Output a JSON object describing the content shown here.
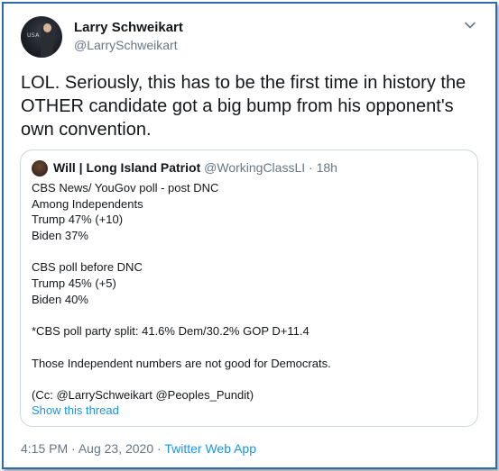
{
  "author": {
    "name": "Larry Schweikart",
    "handle": "@LarrySchweikart",
    "avatar_text": "USA"
  },
  "tweet_text": "LOL. Seriously, this has to be the first time in history the OTHER candidate got a big bump from his opponent's own convention.",
  "quoted": {
    "name": "Will | Long Island Patriot",
    "handle": "@WorkingClassLI",
    "separator": "·",
    "time": "18h",
    "lines": [
      "CBS News/ YouGov poll - post DNC",
      "Among Independents",
      "Trump 47% (+10)",
      "Biden 37%",
      "",
      "CBS poll before DNC",
      "Trump 45% (+5)",
      "Biden 40%",
      "",
      "*CBS poll party split: 41.6% Dem/30.2% GOP D+11.4",
      "",
      "Those Independent numbers are not good for Democrats.",
      "",
      "(Cc: @LarrySchweikart @Peoples_Pundit)"
    ],
    "show_thread": "Show this thread"
  },
  "footer": {
    "time": "4:15 PM",
    "separator1": "·",
    "date": "Aug 23, 2020",
    "separator2": "·",
    "source": "Twitter Web App"
  },
  "colors": {
    "frame_border": "#2b6cb0",
    "link": "#1b95e0",
    "secondary_text": "#657786",
    "primary_text": "#14171a"
  }
}
